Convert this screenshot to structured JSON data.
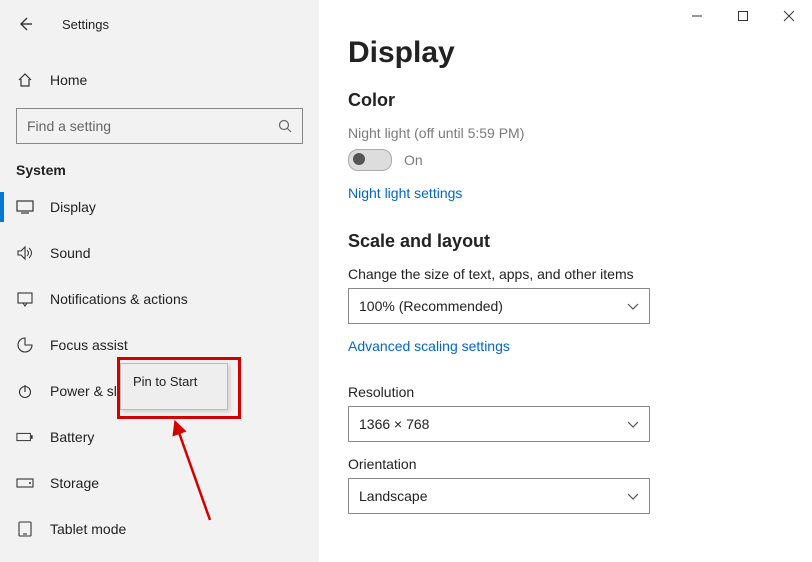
{
  "window": {
    "title": "Settings"
  },
  "sidebar": {
    "home_label": "Home",
    "search_placeholder": "Find a setting",
    "section_label": "System",
    "items": [
      {
        "label": "Display",
        "selected": true
      },
      {
        "label": "Sound"
      },
      {
        "label": "Notifications & actions"
      },
      {
        "label": "Focus assist"
      },
      {
        "label": "Power & sleep"
      },
      {
        "label": "Battery"
      },
      {
        "label": "Storage"
      },
      {
        "label": "Tablet mode"
      }
    ]
  },
  "context_menu": {
    "pin_label": "Pin to Start"
  },
  "main": {
    "page_title": "Display",
    "color_heading": "Color",
    "night_light_status": "Night light (off until 5:59 PM)",
    "toggle_label": "On",
    "night_light_link": "Night light settings",
    "scale_heading": "Scale and layout",
    "scale_label": "Change the size of text, apps, and other items",
    "scale_value": "100% (Recommended)",
    "adv_scaling_link": "Advanced scaling settings",
    "resolution_label": "Resolution",
    "resolution_value": "1366 × 768",
    "orientation_label": "Orientation",
    "orientation_value": "Landscape"
  }
}
